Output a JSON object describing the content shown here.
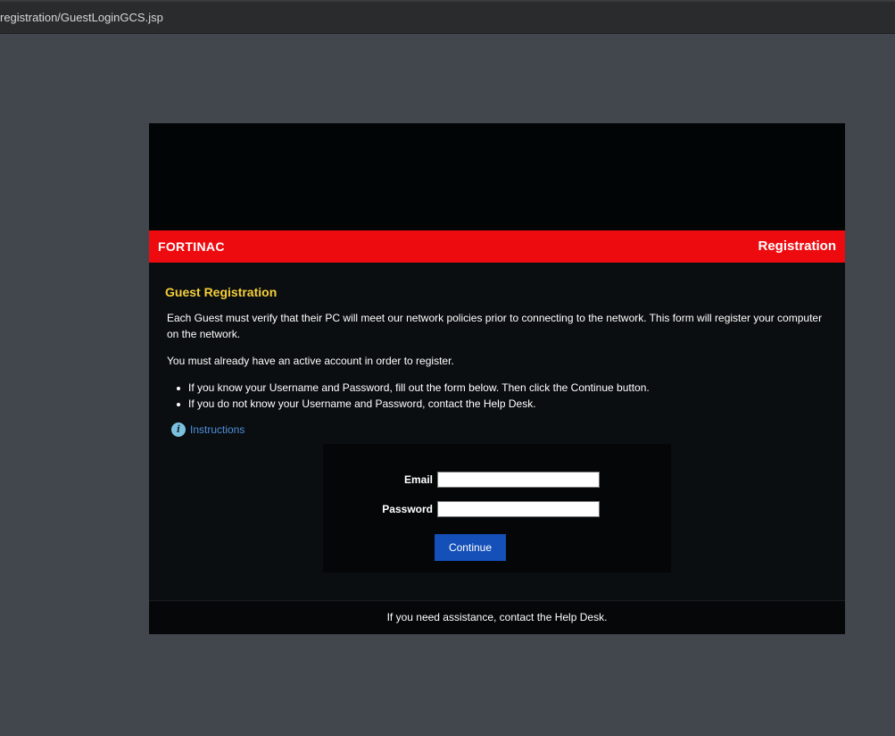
{
  "browser": {
    "url": "registration/GuestLoginGCS.jsp"
  },
  "header": {
    "brand": "FORTINAC",
    "title": "Registration"
  },
  "content": {
    "heading": "Guest Registration",
    "paragraph1": "Each Guest must verify that their PC will meet our network policies prior to connecting to the network. This form will register your computer on the network.",
    "paragraph2": "You must already have an active account in order to register.",
    "bullets": [
      "If you know your Username and Password, fill out the form below. Then click the Continue button.",
      "If you do not know your Username and Password, contact the Help Desk."
    ],
    "instructions_link": "Instructions",
    "instructions_icon": "info-icon"
  },
  "form": {
    "email_label": "Email",
    "email_value": "",
    "password_label": "Password",
    "password_value": "",
    "continue_label": "Continue"
  },
  "footer": {
    "text": "If you need assistance, contact the Help Desk."
  },
  "colors": {
    "page_background": "#42464d",
    "header_bar": "#ee0b10",
    "heading": "#f4cf3a",
    "link": "#4d8fdc",
    "button": "#1550b8"
  }
}
